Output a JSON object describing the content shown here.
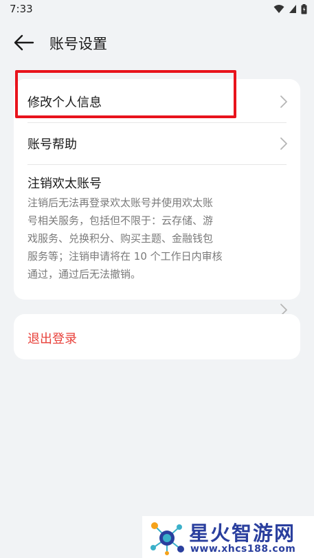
{
  "status_bar": {
    "time": "7:33",
    "icons": [
      "wifi-icon",
      "signal-icon",
      "battery-icon"
    ]
  },
  "header": {
    "back_icon": "arrow-left-icon",
    "title": "账号设置"
  },
  "account_card": {
    "items": [
      {
        "label": "修改个人信息",
        "icon": "chevron-right-icon"
      },
      {
        "label": "账号帮助",
        "icon": "chevron-right-icon"
      },
      {
        "label": "注销欢太账号",
        "description_lines": [
          "注销后无法再登录欢太账号并使用欢太账",
          "号相关服务，包括但不限于：云存储、游",
          "戏服务、兑换积分、购买主题、金融钱包",
          "服务等；注销申请将在 10 个工作日内审核",
          "通过，通过后无法撤销。"
        ],
        "icon": "chevron-right-icon"
      }
    ]
  },
  "logout": {
    "label": "退出登录",
    "color": "#e8403a"
  },
  "annotation": {
    "highlight_color": "#e8131c"
  },
  "watermark": {
    "title": "星火智游网",
    "url": "www.xhcs188.com"
  }
}
